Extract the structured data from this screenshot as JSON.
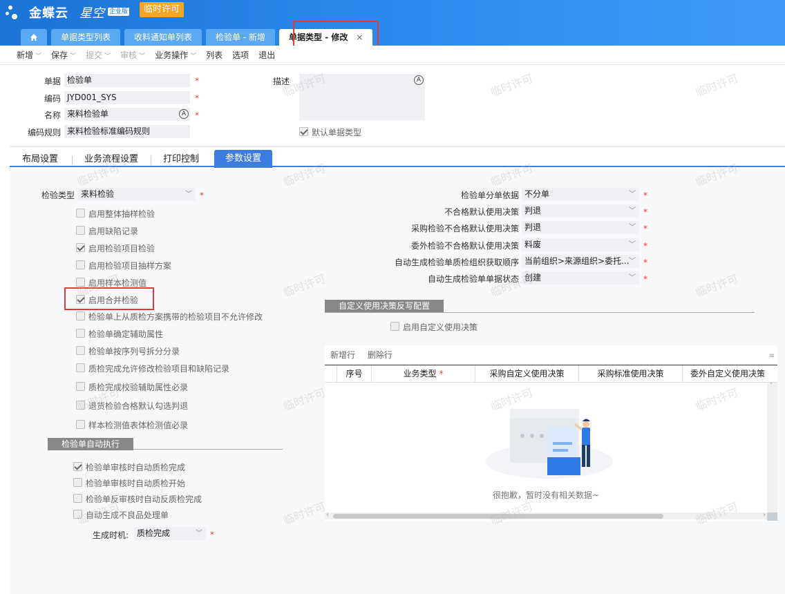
{
  "app": {
    "brand": "金蝶云",
    "brand_sub": "星空",
    "edition": "企业版",
    "license_badge": "临时许可"
  },
  "tabs": [
    {
      "label": "单据类型列表"
    },
    {
      "label": "收料通知单列表"
    },
    {
      "label": "检验单 - 新增"
    },
    {
      "label": "单据类型 - 修改",
      "close": "×"
    }
  ],
  "toolbar": {
    "new": "新增",
    "save": "保存",
    "submit": "提交",
    "audit": "审核",
    "business": "业务操作",
    "list": "列表",
    "options": "选项",
    "exit": "退出"
  },
  "form": {
    "doc_label": "单据",
    "doc_value": "检验单",
    "code_label": "编码",
    "code_value": "JYD001_SYS",
    "name_label": "名称",
    "name_value": "来料检验单",
    "rule_label": "编码规则",
    "rule_value": "来料检验标准编码规则",
    "desc_label": "描述",
    "default_type_label": "默认单据类型",
    "req_mark": "*",
    "lang_icon": "A"
  },
  "subtabs": [
    "布局设置",
    "业务流程设置",
    "打印控制",
    "参数设置"
  ],
  "params": {
    "inspect_type_label": "检验类型",
    "inspect_type_value": "来料检验",
    "left_checks": [
      {
        "label": "启用整体抽样检验",
        "checked": false
      },
      {
        "label": "启用缺陷记录",
        "checked": false
      },
      {
        "label": "启用检验项目检验",
        "checked": true
      },
      {
        "label": "启用检验项目抽样方案",
        "checked": false
      },
      {
        "label": "启用样本检测值",
        "checked": false
      },
      {
        "label": "启用合并检验",
        "checked": true
      },
      {
        "label": "检验单上从质检方案携带的检验项目不允许修改",
        "checked": false
      },
      {
        "label": "检验单确定辅助属性",
        "checked": false
      },
      {
        "label": "检验单按序列号拆分分录",
        "checked": false
      },
      {
        "label": "质检完成允许修改检验项目和缺陷记录",
        "checked": false
      },
      {
        "label": "质检完成校验辅助属性必录",
        "checked": false
      },
      {
        "label": "退货检验合格默认勾选判退",
        "checked": false
      },
      {
        "label": "样本检测值表体检测值必录",
        "checked": false
      }
    ],
    "auto_section": "检验单自动执行",
    "auto_checks": [
      {
        "label": "检验单审核时自动质检完成",
        "checked": true
      },
      {
        "label": "检验单审核时自动质检开始",
        "checked": false
      },
      {
        "label": "检验单反审核时自动反质检完成",
        "checked": false
      },
      {
        "label": "自动生成不良品处理单",
        "checked": false
      }
    ],
    "gen_time_label": "生成时机:",
    "gen_time_value": "质检完成",
    "right_fields": [
      {
        "label": "检验单分单依据",
        "value": "不分单"
      },
      {
        "label": "不合格默认使用决策",
        "value": "判退"
      },
      {
        "label": "采购检验不合格默认使用决策",
        "value": "判退"
      },
      {
        "label": "委外检验不合格默认使用决策",
        "value": "料废"
      },
      {
        "label": "自动生成检验单质检组织获取顺序",
        "value": "当前组织>来源组织>委托..."
      },
      {
        "label": "自动生成检验单单据状态",
        "value": "创建"
      }
    ],
    "custom_section": "自定义使用决策反写配置",
    "custom_enable_label": "启用自定义使用决策"
  },
  "grid": {
    "add_row": "新增行",
    "del_row": "删除行",
    "columns": [
      "序号",
      "业务类型",
      "采购自定义使用决策",
      "采购标准使用决策",
      "委外自定义使用决策"
    ],
    "empty_text": "很抱歉，暂时没有相关数据~"
  },
  "watermark": "临时许可"
}
